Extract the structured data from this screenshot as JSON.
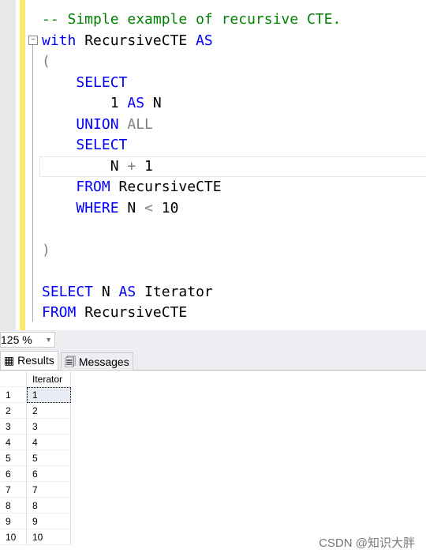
{
  "editor": {
    "lines": [
      {
        "parts": [
          {
            "t": "-- Simple example of recursive CTE.",
            "c": "cm"
          }
        ]
      },
      {
        "parts": [
          {
            "t": "with",
            "c": "kw"
          },
          {
            "t": " RecursiveCTE ",
            "c": ""
          },
          {
            "t": "AS",
            "c": "kw"
          }
        ]
      },
      {
        "parts": [
          {
            "t": "(",
            "c": "gr"
          }
        ]
      },
      {
        "parts": [
          {
            "t": "    ",
            "c": ""
          },
          {
            "t": "SELECT",
            "c": "kw"
          }
        ]
      },
      {
        "parts": [
          {
            "t": "        1 ",
            "c": ""
          },
          {
            "t": "AS",
            "c": "kw"
          },
          {
            "t": " N",
            "c": ""
          }
        ]
      },
      {
        "parts": [
          {
            "t": "    ",
            "c": ""
          },
          {
            "t": "UNION",
            "c": "kw"
          },
          {
            "t": " ALL",
            "c": "gr"
          }
        ]
      },
      {
        "parts": [
          {
            "t": "    ",
            "c": ""
          },
          {
            "t": "SELECT",
            "c": "kw"
          }
        ]
      },
      {
        "parts": [
          {
            "t": "        N ",
            "c": ""
          },
          {
            "t": "+",
            "c": "gr"
          },
          {
            "t": " 1",
            "c": ""
          }
        ]
      },
      {
        "parts": [
          {
            "t": "    ",
            "c": ""
          },
          {
            "t": "FROM",
            "c": "kw"
          },
          {
            "t": " RecursiveCTE",
            "c": ""
          }
        ]
      },
      {
        "parts": [
          {
            "t": "    ",
            "c": ""
          },
          {
            "t": "WHERE",
            "c": "kw"
          },
          {
            "t": " N ",
            "c": ""
          },
          {
            "t": "<",
            "c": "gr"
          },
          {
            "t": " 10",
            "c": ""
          }
        ]
      },
      {
        "parts": []
      },
      {
        "parts": [
          {
            "t": ")",
            "c": "gr"
          }
        ]
      },
      {
        "parts": []
      },
      {
        "parts": [
          {
            "t": "SELECT",
            "c": "kw"
          },
          {
            "t": " N ",
            "c": ""
          },
          {
            "t": "AS",
            "c": "kw"
          },
          {
            "t": " Iterator",
            "c": ""
          }
        ]
      },
      {
        "parts": [
          {
            "t": "FROM",
            "c": "kw"
          },
          {
            "t": " RecursiveCTE",
            "c": ""
          }
        ]
      }
    ]
  },
  "zoom": "125 %",
  "tabs": {
    "results": "Results",
    "messages": "Messages"
  },
  "grid": {
    "header": "Iterator",
    "rows": [
      [
        "1",
        "1"
      ],
      [
        "2",
        "2"
      ],
      [
        "3",
        "3"
      ],
      [
        "4",
        "4"
      ],
      [
        "5",
        "5"
      ],
      [
        "6",
        "6"
      ],
      [
        "7",
        "7"
      ],
      [
        "8",
        "8"
      ],
      [
        "9",
        "9"
      ],
      [
        "10",
        "10"
      ]
    ]
  },
  "watermark": "CSDN @知识大胖"
}
